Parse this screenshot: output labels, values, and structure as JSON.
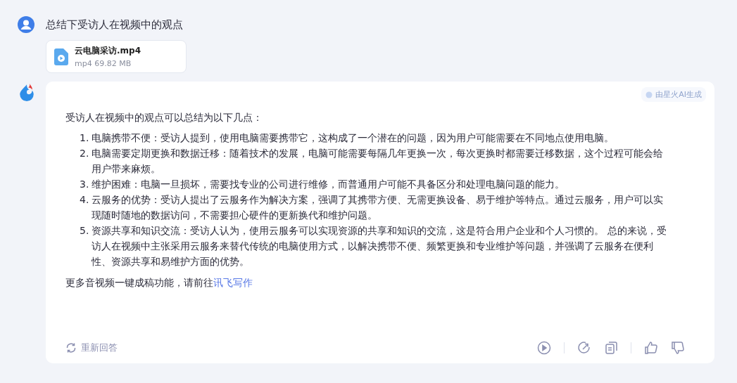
{
  "question": {
    "text": "总结下受访人在视频中的观点"
  },
  "attachment": {
    "name": "云电脑采访.mp4",
    "meta": "mp4 69.82 MB"
  },
  "answer": {
    "badge": "由星火AI生成",
    "intro": "受访人在视频中的观点可以总结为以下几点：",
    "points": [
      {
        "number": "1.",
        "text": "电脑携带不便：受访人提到，使用电脑需要携带它，这构成了一个潜在的问题，因为用户可能需要在不同地点使用电脑。"
      },
      {
        "number": "2.",
        "text": "电脑需要定期更换和数据迁移：随着技术的发展，电脑可能需要每隔几年更换一次，每次更换时都需要迁移数据，这个过程可能会给用户带来麻烦。"
      },
      {
        "number": "3.",
        "text": "维护困难：电脑一旦损坏，需要找专业的公司进行维修，而普通用户可能不具备区分和处理电脑问题的能力。"
      },
      {
        "number": "4.",
        "text": "云服务的优势：受访人提出了云服务作为解决方案，强调了其携带方便、无需更换设备、易于维护等特点。通过云服务，用户可以实现随时随地的数据访问，不需要担心硬件的更新换代和维护问题。"
      },
      {
        "number": "5.",
        "text": "资源共享和知识交流：受访人认为，使用云服务可以实现资源的共享和知识的交流，这是符合用户企业和个人习惯的。 总的来说，受访人在视频中主张采用云服务来替代传统的电脑使用方式，以解决携带不便、频繁更换和专业维护等问题，并强调了云服务在便利性、资源共享和易维护方面的优势。"
      }
    ],
    "footer_text": "更多音视频一键成稿功能，请前往",
    "footer_link": "讯飞写作",
    "regenerate": "重新回答"
  }
}
